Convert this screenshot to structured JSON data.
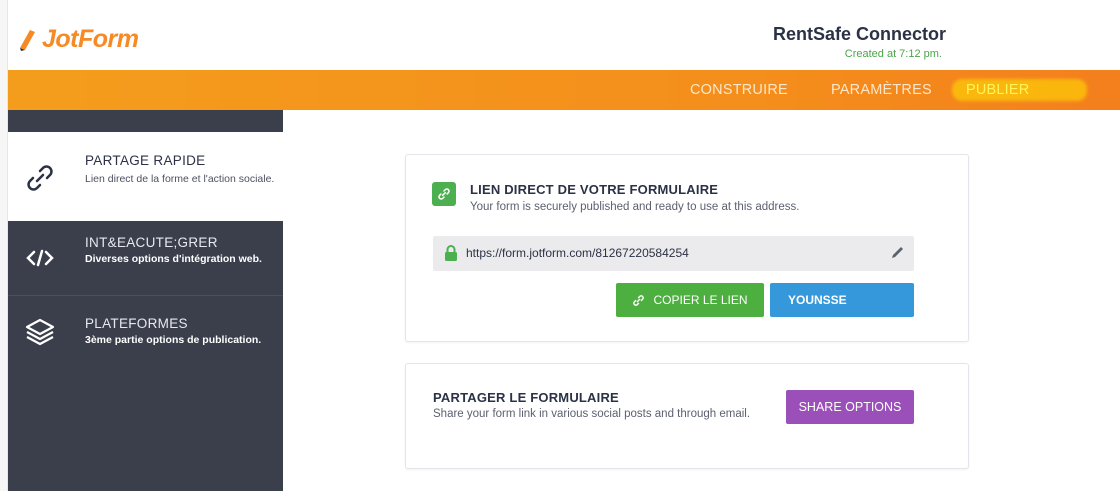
{
  "app": {
    "logo_text": "JotForm"
  },
  "form": {
    "title": "RentSafe Connector",
    "created": "Created at 7:12 pm."
  },
  "nav": {
    "tabs": [
      {
        "label": "CONSTRUIRE"
      },
      {
        "label": "PARAMÈTRES"
      },
      {
        "label": "PUBLIER",
        "active": true
      }
    ]
  },
  "sidebar": {
    "items": [
      {
        "title": "PARTAGE RAPIDE",
        "description": "Lien direct de la forme et l'action sociale.",
        "icon": "link-icon",
        "active": true
      },
      {
        "title": "INT&EACUTE;GRER",
        "description": "Diverses options d'intégration web.",
        "icon": "code-icon"
      },
      {
        "title": "PLATEFORMES",
        "description": "3ème partie options de publication.",
        "icon": "layers-icon"
      }
    ]
  },
  "direct_link": {
    "heading": "LIEN DIRECT DE VOTRE FORMULAIRE",
    "subtext": "Your form is securely published and ready to use at this address.",
    "url": "https://form.jotform.com/81267220584254",
    "copy_label": "COPIER LE LIEN",
    "second_button_label": "YOUNSSE"
  },
  "share_form": {
    "heading": "PARTAGER LE FORMULAIRE",
    "subtext": "Share your form link in various social posts and through email.",
    "button_label": "SHARE OPTIONS"
  },
  "colors": {
    "brand": "#f68a24",
    "nav": "#f49d1c",
    "sidebar": "#3b3f4c",
    "green": "#4caf3f",
    "blue": "#3498db",
    "purple": "#9b4fb8"
  }
}
